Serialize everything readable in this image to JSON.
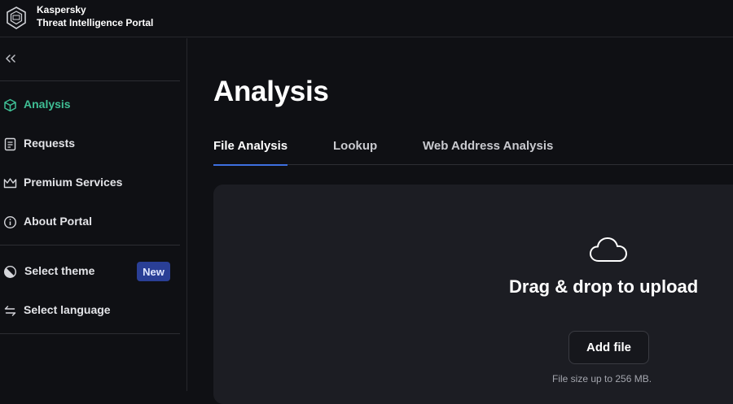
{
  "header": {
    "brand_line1": "Kaspersky",
    "brand_line2": "Threat Intelligence Portal",
    "logo_icon": "kaspersky-shield-icon"
  },
  "sidebar": {
    "collapse_icon": "chevrons-left-icon",
    "items": [
      {
        "label": "Analysis",
        "icon": "cube-icon",
        "active": true
      },
      {
        "label": "Requests",
        "icon": "document-icon",
        "active": false
      },
      {
        "label": "Premium Services",
        "icon": "crown-icon",
        "active": false
      },
      {
        "label": "About Portal",
        "icon": "info-icon",
        "active": false
      }
    ],
    "settings": [
      {
        "label": "Select theme",
        "icon": "theme-icon",
        "badge": "New"
      },
      {
        "label": "Select language",
        "icon": "language-arrows-icon"
      }
    ]
  },
  "main": {
    "title": "Analysis",
    "tabs": [
      {
        "label": "File Analysis",
        "active": true
      },
      {
        "label": "Lookup",
        "active": false
      },
      {
        "label": "Web Address Analysis",
        "active": false
      }
    ],
    "dropzone": {
      "icon": "cloud-icon",
      "title": "Drag & drop to upload",
      "button_label": "Add file",
      "note": "File size up to 256 MB."
    }
  },
  "colors": {
    "accent_green": "#3fbf95",
    "tab_underline": "#3d6fe0",
    "badge_bg": "#2a3f96",
    "background": "#0f1014",
    "panel": "#1c1d23"
  }
}
